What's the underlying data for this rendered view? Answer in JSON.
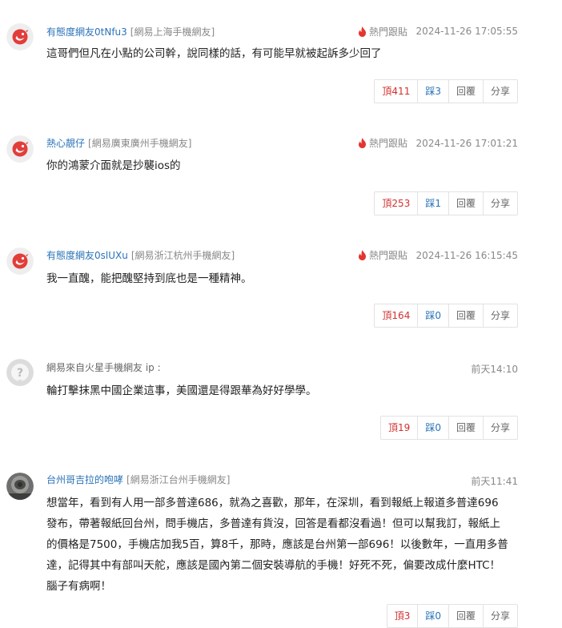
{
  "comments": [
    {
      "user": "有態度網友0tNfu3",
      "location": "[網易上海手機網友]",
      "hot_label": "熱門跟貼",
      "time": "2024-11-26 17:05:55",
      "text": "這哥們但凡在小點的公司幹，說同樣的話，有可能早就被起訴多少回了",
      "up_label": "頂411",
      "down_label": "踩3",
      "reply_label": "回覆",
      "share_label": "分享"
    },
    {
      "user": "熱心靚仔",
      "location": "[網易廣東廣州手機網友]",
      "hot_label": "熱門跟貼",
      "time": "2024-11-26 17:01:21",
      "text": "你的鴻蒙介面就是抄襲ios的",
      "up_label": "頂253",
      "down_label": "踩1",
      "reply_label": "回覆",
      "share_label": "分享"
    },
    {
      "user": "有態度網友0slUXu",
      "location": "[網易浙江杭州手機網友]",
      "hot_label": "熱門跟貼",
      "time": "2024-11-26 16:15:45",
      "text": "我一直醜，能把醜堅持到底也是一種精神。",
      "up_label": "頂164",
      "down_label": "踩0",
      "reply_label": "回覆",
      "share_label": "分享"
    },
    {
      "user": "網易來自火星手機網友 ip :",
      "location": "",
      "time": "前天14:10",
      "text": "輪打擊抹黑中國企業這事，美國還是得跟華為好好學學。",
      "up_label": "頂19",
      "down_label": "踩0",
      "reply_label": "回覆",
      "share_label": "分享"
    },
    {
      "user": "台州哥吉拉的咆哮",
      "location": "[網易浙江台州手機網友]",
      "time": "前天11:41",
      "text_lines": [
        "想當年，看到有人用一部多普達686，就為之喜歡，那年，在深圳，看到報紙上報道多普達696",
        "發布，帶著報紙回台州，問手機店，多普達有貨沒，回答是看都沒看過！但可以幫我訂，報紙上",
        "的價格是7500，手機店加我5百，算8千，那時，應該是台州第一部696！以後數年，一直用多普",
        "達，記得其中有部叫天舵，應該是國內第二個安裝導航的手機！好死不死，偏要改成什麼HTC！",
        "腦子有病啊！"
      ],
      "up_label": "頂3",
      "down_label": "踩0",
      "reply_label": "回覆",
      "share_label": "分享"
    }
  ],
  "colors": {
    "username": "#2a73b8",
    "up": "#d2312e",
    "down": "#2a73b8",
    "hot_flame": "#e2362f"
  },
  "icons": {
    "avatar_default": "netease-avatar-icon",
    "avatar_anonymous": "anonymous-avatar-icon",
    "avatar_photo": "user-photo-avatar",
    "hot": "flame-icon"
  }
}
